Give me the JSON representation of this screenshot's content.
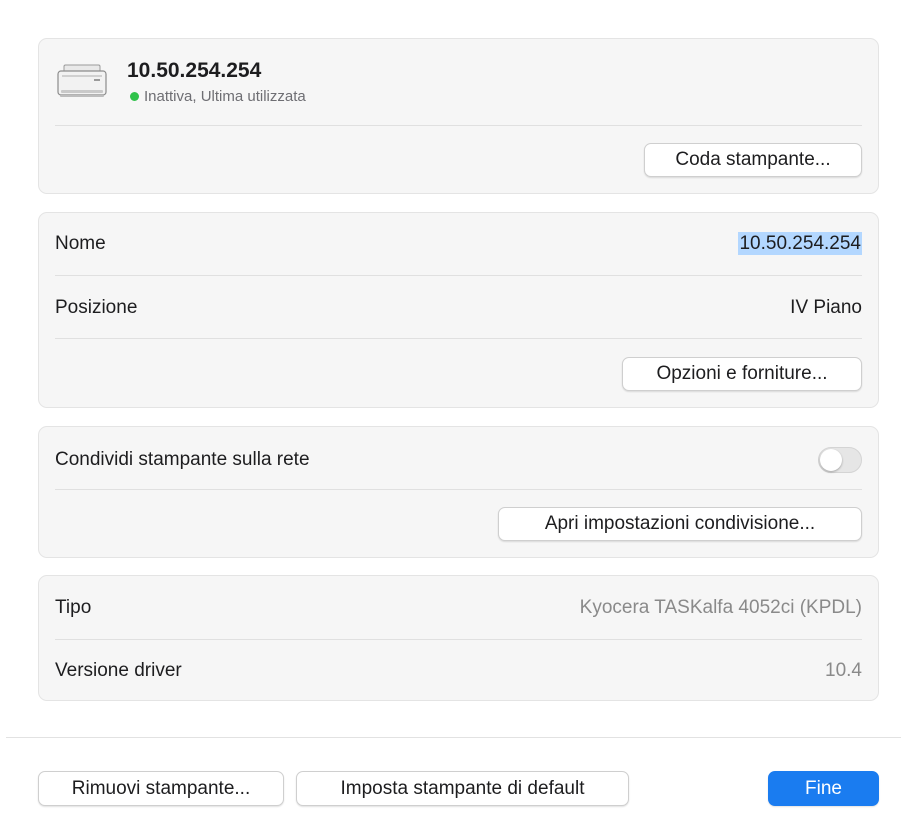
{
  "printer": {
    "name": "10.50.254.254",
    "status_text": "Inattiva, Ultima utilizzata",
    "status_color": "#2fc24a",
    "icon": "printer-icon",
    "queue_button": "Coda stampante..."
  },
  "details": {
    "name_label": "Nome",
    "name_value": "10.50.254.254",
    "location_label": "Posizione",
    "location_value": "IV Piano",
    "options_button": "Opzioni e forniture..."
  },
  "sharing": {
    "label": "Condividi stampante sulla rete",
    "toggle_on": false,
    "settings_button": "Apri impostazioni condivisione..."
  },
  "info": {
    "type_label": "Tipo",
    "type_value": "Kyocera TASKalfa 4052ci (KPDL)",
    "driver_label": "Versione driver",
    "driver_value": "10.4"
  },
  "footer": {
    "remove_button": "Rimuovi stampante...",
    "default_button": "Imposta stampante di default",
    "done_button": "Fine"
  },
  "colors": {
    "accent": "#1a7cf0",
    "selection": "#b3d7ff"
  }
}
